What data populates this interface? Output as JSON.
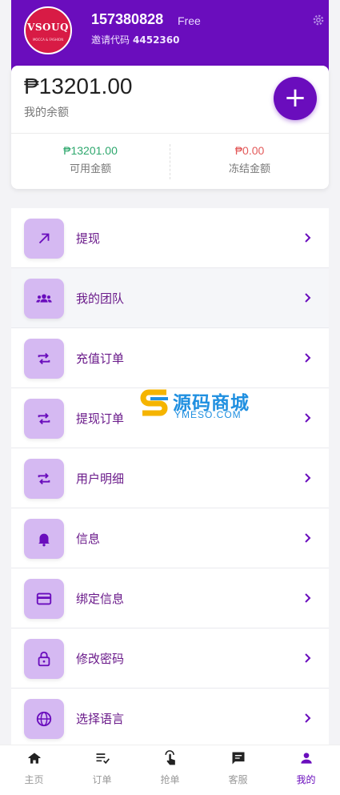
{
  "header": {
    "logo_text": "VSOUQ",
    "logo_sub": "MOCCA & FASHION",
    "user_id": "157380828",
    "tier": "Free",
    "invite_label": "邀请代码",
    "invite_code": "4452360",
    "settings_icon": "gear-icon"
  },
  "balance": {
    "amount": "₱13201.00",
    "label": "我的余额",
    "add_icon": "plus-icon",
    "available": {
      "value": "₱13201.00",
      "label": "可用金额",
      "color": "#2fa86e"
    },
    "frozen": {
      "value": "₱0.00",
      "label": "冻结金额",
      "color": "#e35a5a"
    }
  },
  "menu": [
    {
      "label": "提现",
      "icon": "arrow-up-right-icon"
    },
    {
      "label": "我的团队",
      "icon": "group-icon"
    },
    {
      "label": "充值订单",
      "icon": "repeat-icon"
    },
    {
      "label": "提现订单",
      "icon": "repeat-icon"
    },
    {
      "label": "用户明细",
      "icon": "repeat-icon"
    },
    {
      "label": "信息",
      "icon": "bell-icon"
    },
    {
      "label": "绑定信息",
      "icon": "credit-card-icon"
    },
    {
      "label": "修改密码",
      "icon": "lock-icon"
    },
    {
      "label": "选择语言",
      "icon": "globe-icon"
    }
  ],
  "watermark": {
    "text": "源码商城",
    "sub": "YMESO.COM"
  },
  "tabbar": [
    {
      "label": "主页",
      "icon": "home-icon"
    },
    {
      "label": "订单",
      "icon": "list-check-icon"
    },
    {
      "label": "抢单",
      "icon": "touch-icon"
    },
    {
      "label": "客服",
      "icon": "chat-icon"
    },
    {
      "label": "我的",
      "icon": "person-icon"
    }
  ],
  "colors": {
    "accent": "#6a0dbd",
    "icon_bg": "#d5b9f2",
    "menu_text": "#6a1a8a"
  }
}
